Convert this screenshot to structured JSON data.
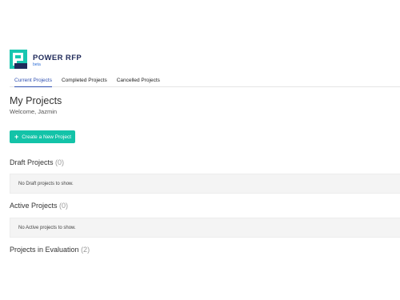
{
  "brand": {
    "name": "POWER RFP",
    "sub": "beta",
    "colors": {
      "navy": "#1f2a5a",
      "teal": "#19c6b0",
      "blue": "#2f4fb0"
    }
  },
  "tabs": [
    {
      "label": "Current Projects",
      "active": true
    },
    {
      "label": "Completed Projects",
      "active": false
    },
    {
      "label": "Cancelled Projects",
      "active": false
    }
  ],
  "main": {
    "title": "My Projects",
    "welcome": "Welcome, Jazmin",
    "create_button": {
      "icon": "plus-icon",
      "label": "Create a New Project",
      "color": "#13c3a8"
    }
  },
  "sections": {
    "draft": {
      "title": "Draft Projects",
      "count": "(0)",
      "empty": "No Draft projects to show."
    },
    "active": {
      "title": "Active Projects",
      "count": "(0)",
      "empty": "No Active projects to show."
    },
    "evaluation": {
      "title": "Projects in Evaluation",
      "count": "(2)"
    }
  }
}
